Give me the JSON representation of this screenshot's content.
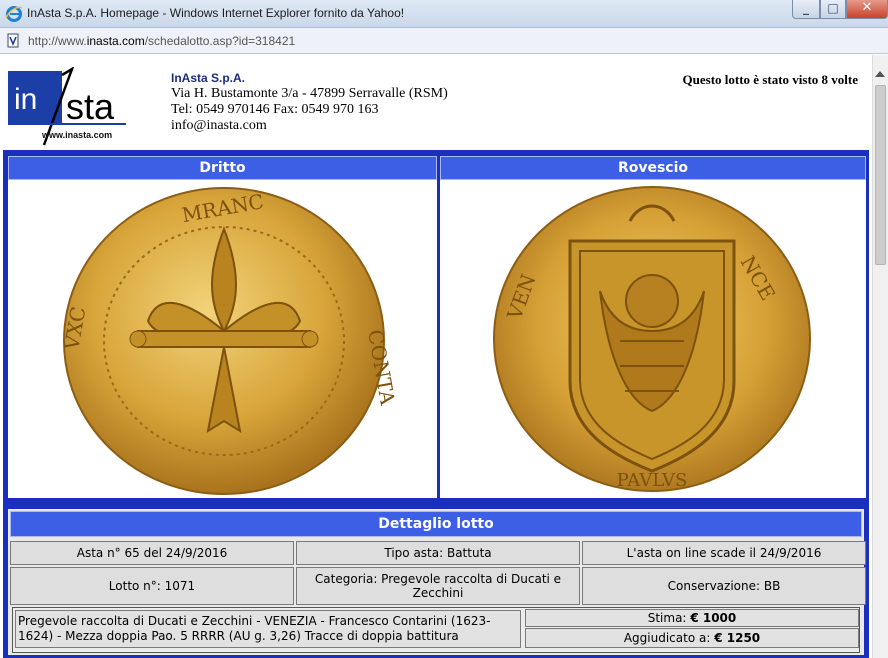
{
  "window": {
    "title": "InAsta S.p.A. Homepage - Windows Internet Explorer fornito da Yahoo!",
    "url_prefix": "http://www.",
    "url_domain": "inasta.com",
    "url_suffix": "/schedalotto.asp?id=318421"
  },
  "header": {
    "logo_url": "www.inasta.com",
    "company_name": "InAsta S.p.A.",
    "address": "Via H. Bustamonte 3/a - 47899 Serravalle (RSM)",
    "phone": "Tel: 0549 970146 Fax: 0549 970 163",
    "email": "info@inasta.com",
    "views": "Questo lotto è stato visto 8 volte"
  },
  "coins": {
    "obverse_label": "Dritto",
    "reverse_label": "Rovescio"
  },
  "details": {
    "title": "Dettaglio lotto",
    "asta": "Asta n° 65 del 24/9/2016",
    "tipo_asta": "Tipo asta: Battuta",
    "scadenza": "L'asta on line scade il 24/9/2016",
    "lotto": "Lotto n°: 1071",
    "categoria": "Categoria: Pregevole raccolta di Ducati e Zecchini",
    "conservazione": "Conservazione: BB",
    "description": "Pregevole raccolta di Ducati e Zecchini - VENEZIA - Francesco Contarini (1623-1624) - Mezza doppia Pao. 5 RRRR (AU g. 3,26) Tracce di doppia battitura",
    "stima_label": "Stima:",
    "stima_value": "€ 1000",
    "aggiudicato_label": "Aggiudicato a:",
    "aggiudicato_value": "€ 1250"
  },
  "colors": {
    "panel_blue": "#1a2fbd",
    "header_blue": "#3d5fe5",
    "coin_gold": "#d9a93a"
  }
}
